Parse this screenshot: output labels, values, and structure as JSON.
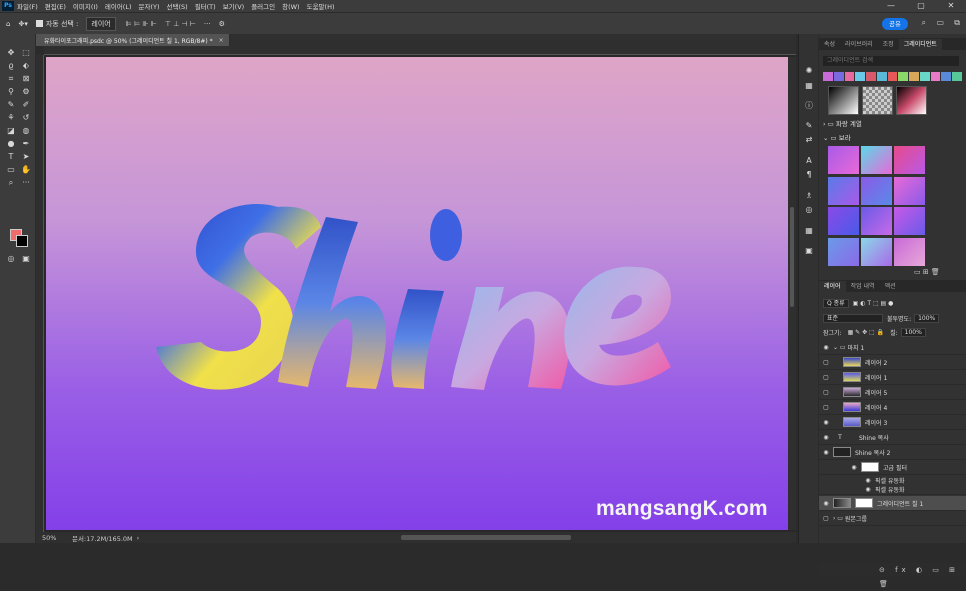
{
  "menubar": {
    "logo": "Ps",
    "items": [
      "파일(F)",
      "편집(E)",
      "이미지(I)",
      "레이어(L)",
      "문자(Y)",
      "선택(S)",
      "필터(T)",
      "보기(V)",
      "플러그인",
      "창(W)",
      "도움말(H)"
    ],
    "window_controls": [
      "—",
      "▢",
      "✕"
    ]
  },
  "options": {
    "auto_select_label": "자동 선택 :",
    "auto_select_value": "레이어",
    "more": "···",
    "share_label": "공유"
  },
  "document": {
    "tab_title": "유화타이포그래피.psdc @ 50% (그레이디언트 칠 1, RGB/8#) *",
    "tab_close": "×",
    "zoom": "50%",
    "doc_size": "문서:17.2M/165.0M",
    "watermark": "mangsangK.com"
  },
  "panels": {
    "tabs_top": [
      "속성",
      "라이브러리",
      "조정",
      "그레이디언트"
    ],
    "active_top": "그레이디언트",
    "gradient_search_placeholder": "그레이디언트 검색",
    "folders": [
      "파랑 계열",
      "보라"
    ],
    "layers_tabs": [
      "레이어",
      "작업 내역",
      "액션"
    ],
    "filter_kind": "Q 종류",
    "blend_mode": "표준",
    "opacity_label": "불투명도:",
    "opacity_value": "100%",
    "lock_label": "잠그기:",
    "fill_label": "칠:",
    "fill_value": "100%"
  },
  "layers": [
    {
      "name": "마지 1",
      "type": "group",
      "visible": true
    },
    {
      "name": "레이어 2",
      "type": "pixel",
      "visible": false
    },
    {
      "name": "레이어 1",
      "type": "pixel",
      "visible": false
    },
    {
      "name": "레이어 5",
      "type": "pixel",
      "visible": false
    },
    {
      "name": "레이어 4",
      "type": "pixel",
      "visible": false
    },
    {
      "name": "레이어 3",
      "type": "pixel",
      "visible": true
    },
    {
      "name": "Shine 복사",
      "type": "text",
      "visible": true
    },
    {
      "name": "Shine 복사 2",
      "type": "smart",
      "visible": true
    },
    {
      "name": "고급 필터",
      "type": "filter",
      "visible": true
    },
    {
      "name": "픽셀 유동화",
      "type": "filter",
      "visible": true
    },
    {
      "name": "픽셀 유동화",
      "type": "filter",
      "visible": true
    },
    {
      "name": "그레이디언트 칠 1",
      "type": "fill",
      "visible": true
    },
    {
      "name": "원본그룹",
      "type": "group",
      "visible": false
    }
  ],
  "colors": {
    "foreground": "#f06c6c",
    "background": "#000000",
    "canvas_top": "#dfa5c7",
    "canvas_bottom": "#8440e8"
  },
  "canvas_art_text": "Shine"
}
